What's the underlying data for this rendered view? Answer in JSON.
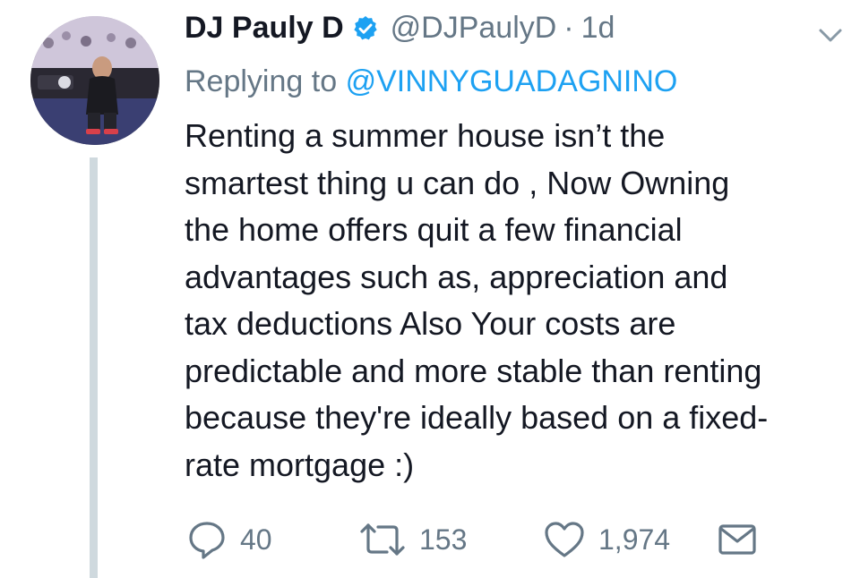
{
  "tweet": {
    "display_name": "DJ Pauly D",
    "handle": "@DJPaulyD",
    "separator": "·",
    "time": "1d",
    "replying_prefix": "Replying to",
    "replying_to": "@VINNYGUADAGNINO",
    "text_lines": [
      "Renting a summer house isn’t the",
      "smartest thing u can do , Now Owning",
      "the home offers quit a few financial",
      "advantages such as, appreciation and",
      "tax deductions Also Your costs are",
      "predictable and more stable than renting",
      "because they're ideally based on a fixed-",
      "rate mortgage :)"
    ]
  },
  "actions": {
    "reply_count": "40",
    "retweet_count": "153",
    "like_count": "1,974"
  },
  "icons": {
    "verified": "verified-badge-icon",
    "caret": "chevron-down-icon",
    "reply": "reply-icon",
    "retweet": "retweet-icon",
    "like": "heart-icon",
    "dm": "envelope-icon"
  },
  "colors": {
    "text": "#141823",
    "muted": "#657786",
    "link": "#1da1f2",
    "thread_line": "#cfd9de"
  }
}
